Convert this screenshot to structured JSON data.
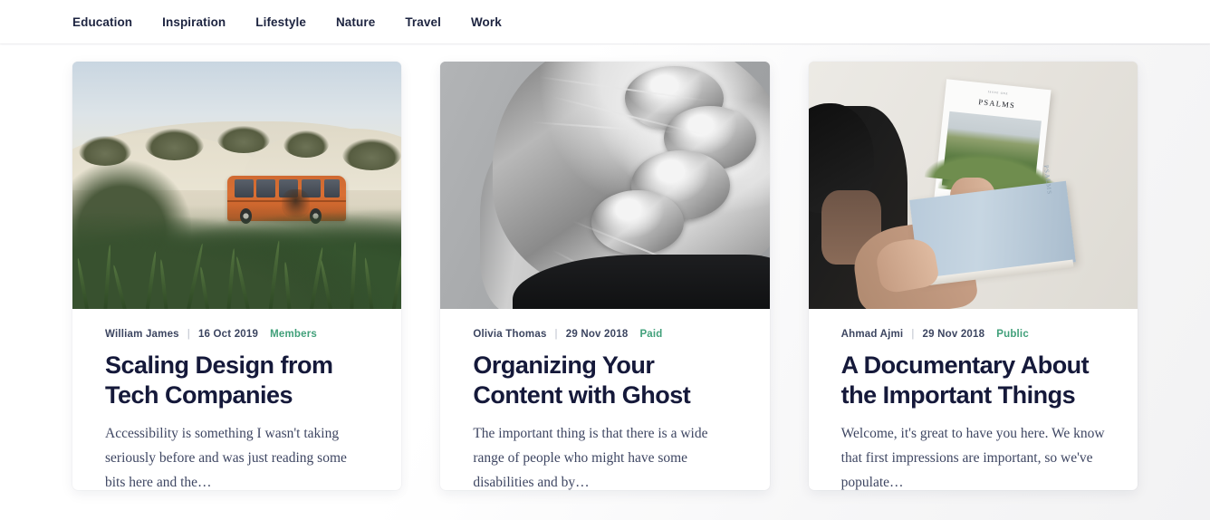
{
  "header": {
    "nav": [
      {
        "label": "Education",
        "name": "nav-item-education"
      },
      {
        "label": "Inspiration",
        "name": "nav-item-inspiration"
      },
      {
        "label": "Lifestyle",
        "name": "nav-item-lifestyle"
      },
      {
        "label": "Nature",
        "name": "nav-item-nature"
      },
      {
        "label": "Travel",
        "name": "nav-item-travel"
      },
      {
        "label": "Work",
        "name": "nav-item-work"
      }
    ]
  },
  "colors": {
    "nav_text": "#1d2440",
    "title": "#15193a",
    "meta": "#3c4560",
    "visibility_green": "#41a07a",
    "card_background": "#ffffff",
    "page_background": "#ffffff"
  },
  "posts": [
    {
      "author": "William James",
      "separator": "|",
      "date": "16 Oct 2019",
      "visibility": "Members",
      "title": "Scaling Design from Tech Companies",
      "excerpt": "Accessibility is something I wasn't taking seriously before and was just reading some bits here and the…",
      "image_alt": "orange-vw-van-on-beach-dunes"
    },
    {
      "author": "Olivia Thomas",
      "separator": "|",
      "date": "29 Nov 2018",
      "visibility": "Paid",
      "title": "Organizing Your Content with Ghost",
      "excerpt": "The important thing is that there is a wide range of people who might have some disabilities and by…",
      "image_alt": "black-and-white-braided-updo-hair"
    },
    {
      "author": "Ahmad Ajmi",
      "separator": "|",
      "date": "29 Nov 2018",
      "visibility": "Public",
      "title": "A Documentary About the Important Things",
      "excerpt": "Welcome, it's great to have you here. We know that first impressions are important, so we've populate…",
      "image_alt": "person-holding-psalms-book-and-blue-book"
    }
  ],
  "image_text": {
    "magazine_kicker": "ISSUE ONE",
    "magazine_title": "PSALMS",
    "blue_book_spine": "PSALMS"
  }
}
